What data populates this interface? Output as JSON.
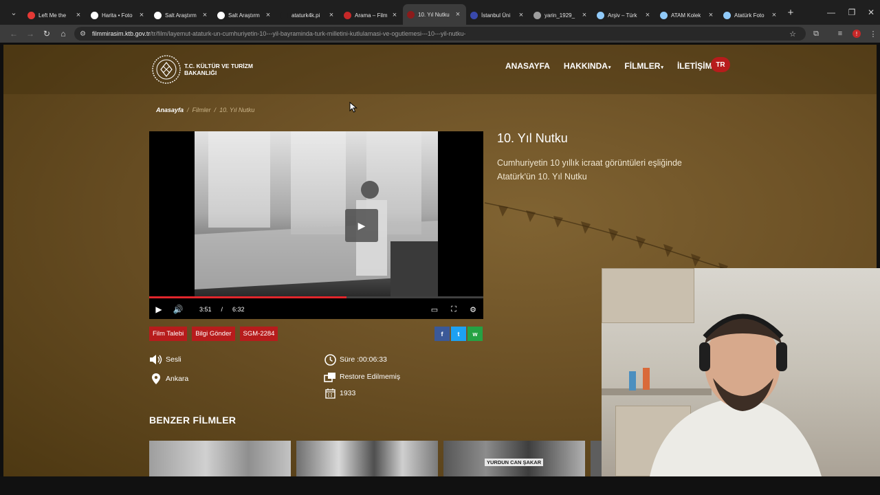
{
  "browser": {
    "tabs": [
      {
        "label": "Left Me the",
        "favicon_color": "#e53935",
        "active": false
      },
      {
        "label": "Harita • Foto",
        "favicon_color": "#ffffff",
        "active": false
      },
      {
        "label": "Salt Araştırm",
        "favicon_color": "#ffffff",
        "active": false
      },
      {
        "label": "Salt Araştırm",
        "favicon_color": "#ffffff",
        "active": false
      },
      {
        "label": "ataturk4k.pi",
        "favicon_color": "#1f1f1f",
        "active": false
      },
      {
        "label": "Arama – Film",
        "favicon_color": "#c62828",
        "active": false
      },
      {
        "label": "10. Yıl Nutku",
        "favicon_color": "#8b1b1b",
        "active": true
      },
      {
        "label": "İstanbul Üni",
        "favicon_color": "#3949ab",
        "active": false
      },
      {
        "label": "yarin_1929_",
        "favicon_color": "#9e9e9e",
        "active": false
      },
      {
        "label": "Arşiv – Türk",
        "favicon_color": "#90caf9",
        "active": false
      },
      {
        "label": "ATAM Kolek",
        "favicon_color": "#90caf9",
        "active": false
      },
      {
        "label": "Atatürk Foto",
        "favicon_color": "#90caf9",
        "active": false
      }
    ],
    "url_host": "filmmirasim.ktb.gov.tr",
    "url_path": "/tr/film/layemut-ataturk-un-cumhuriyetin-10---yil-bayraminda-turk-milletini-kutlulamasi-ve-ogutlemesi---10---yil-nutku-",
    "profile_initial": "!"
  },
  "site": {
    "logo_text": "T.C. KÜLTÜR VE TURİZM BAKANLIĞI",
    "nav": [
      {
        "label": "ANASAYFA",
        "caret": ""
      },
      {
        "label": "HAKKINDA",
        "caret": "▾"
      },
      {
        "label": "FİLMLER",
        "caret": "▾"
      },
      {
        "label": "İLETİŞİM",
        "caret": ""
      }
    ],
    "lang": "TR"
  },
  "breadcrumb": {
    "home": "Anasayfa",
    "separator": "/",
    "section": "Filmler",
    "current": "10. Yıl Nutku"
  },
  "video": {
    "current_time": "3:51",
    "time_separator": "/",
    "duration": "6:32",
    "progress": 0.59
  },
  "film": {
    "title": "10. Yıl Nutku",
    "description": "Cumhuriyetin 10 yıllık icraat görüntüleri eşliğinde Atatürk'ün 10. Yıl Nutku"
  },
  "actions": {
    "request": "Film Talebi",
    "send_info": "Bilgi Gönder",
    "code": "SGM-2284"
  },
  "share": {
    "facebook": "f",
    "twitter": "t",
    "whatsapp": "w"
  },
  "meta": {
    "sound": "Sesli",
    "location": "Ankara",
    "duration": "Süre :00:06:33",
    "restoration": "Restore Edilmemiş",
    "year": "1933"
  },
  "similar": {
    "title": "BENZER FİLMLER",
    "thumb_banner": "YURDUN CAN ŞAKAR"
  },
  "icons": {
    "sound": "volume-icon",
    "location": "map-pin-icon",
    "clock": "clock-icon",
    "restore": "windows-icon",
    "calendar": "calendar-icon"
  },
  "colors": {
    "accent_red": "#b71c1c",
    "progress_red": "#e2262c",
    "facebook": "#3b5998",
    "twitter": "#1da1f2",
    "whatsapp": "#25a244"
  }
}
